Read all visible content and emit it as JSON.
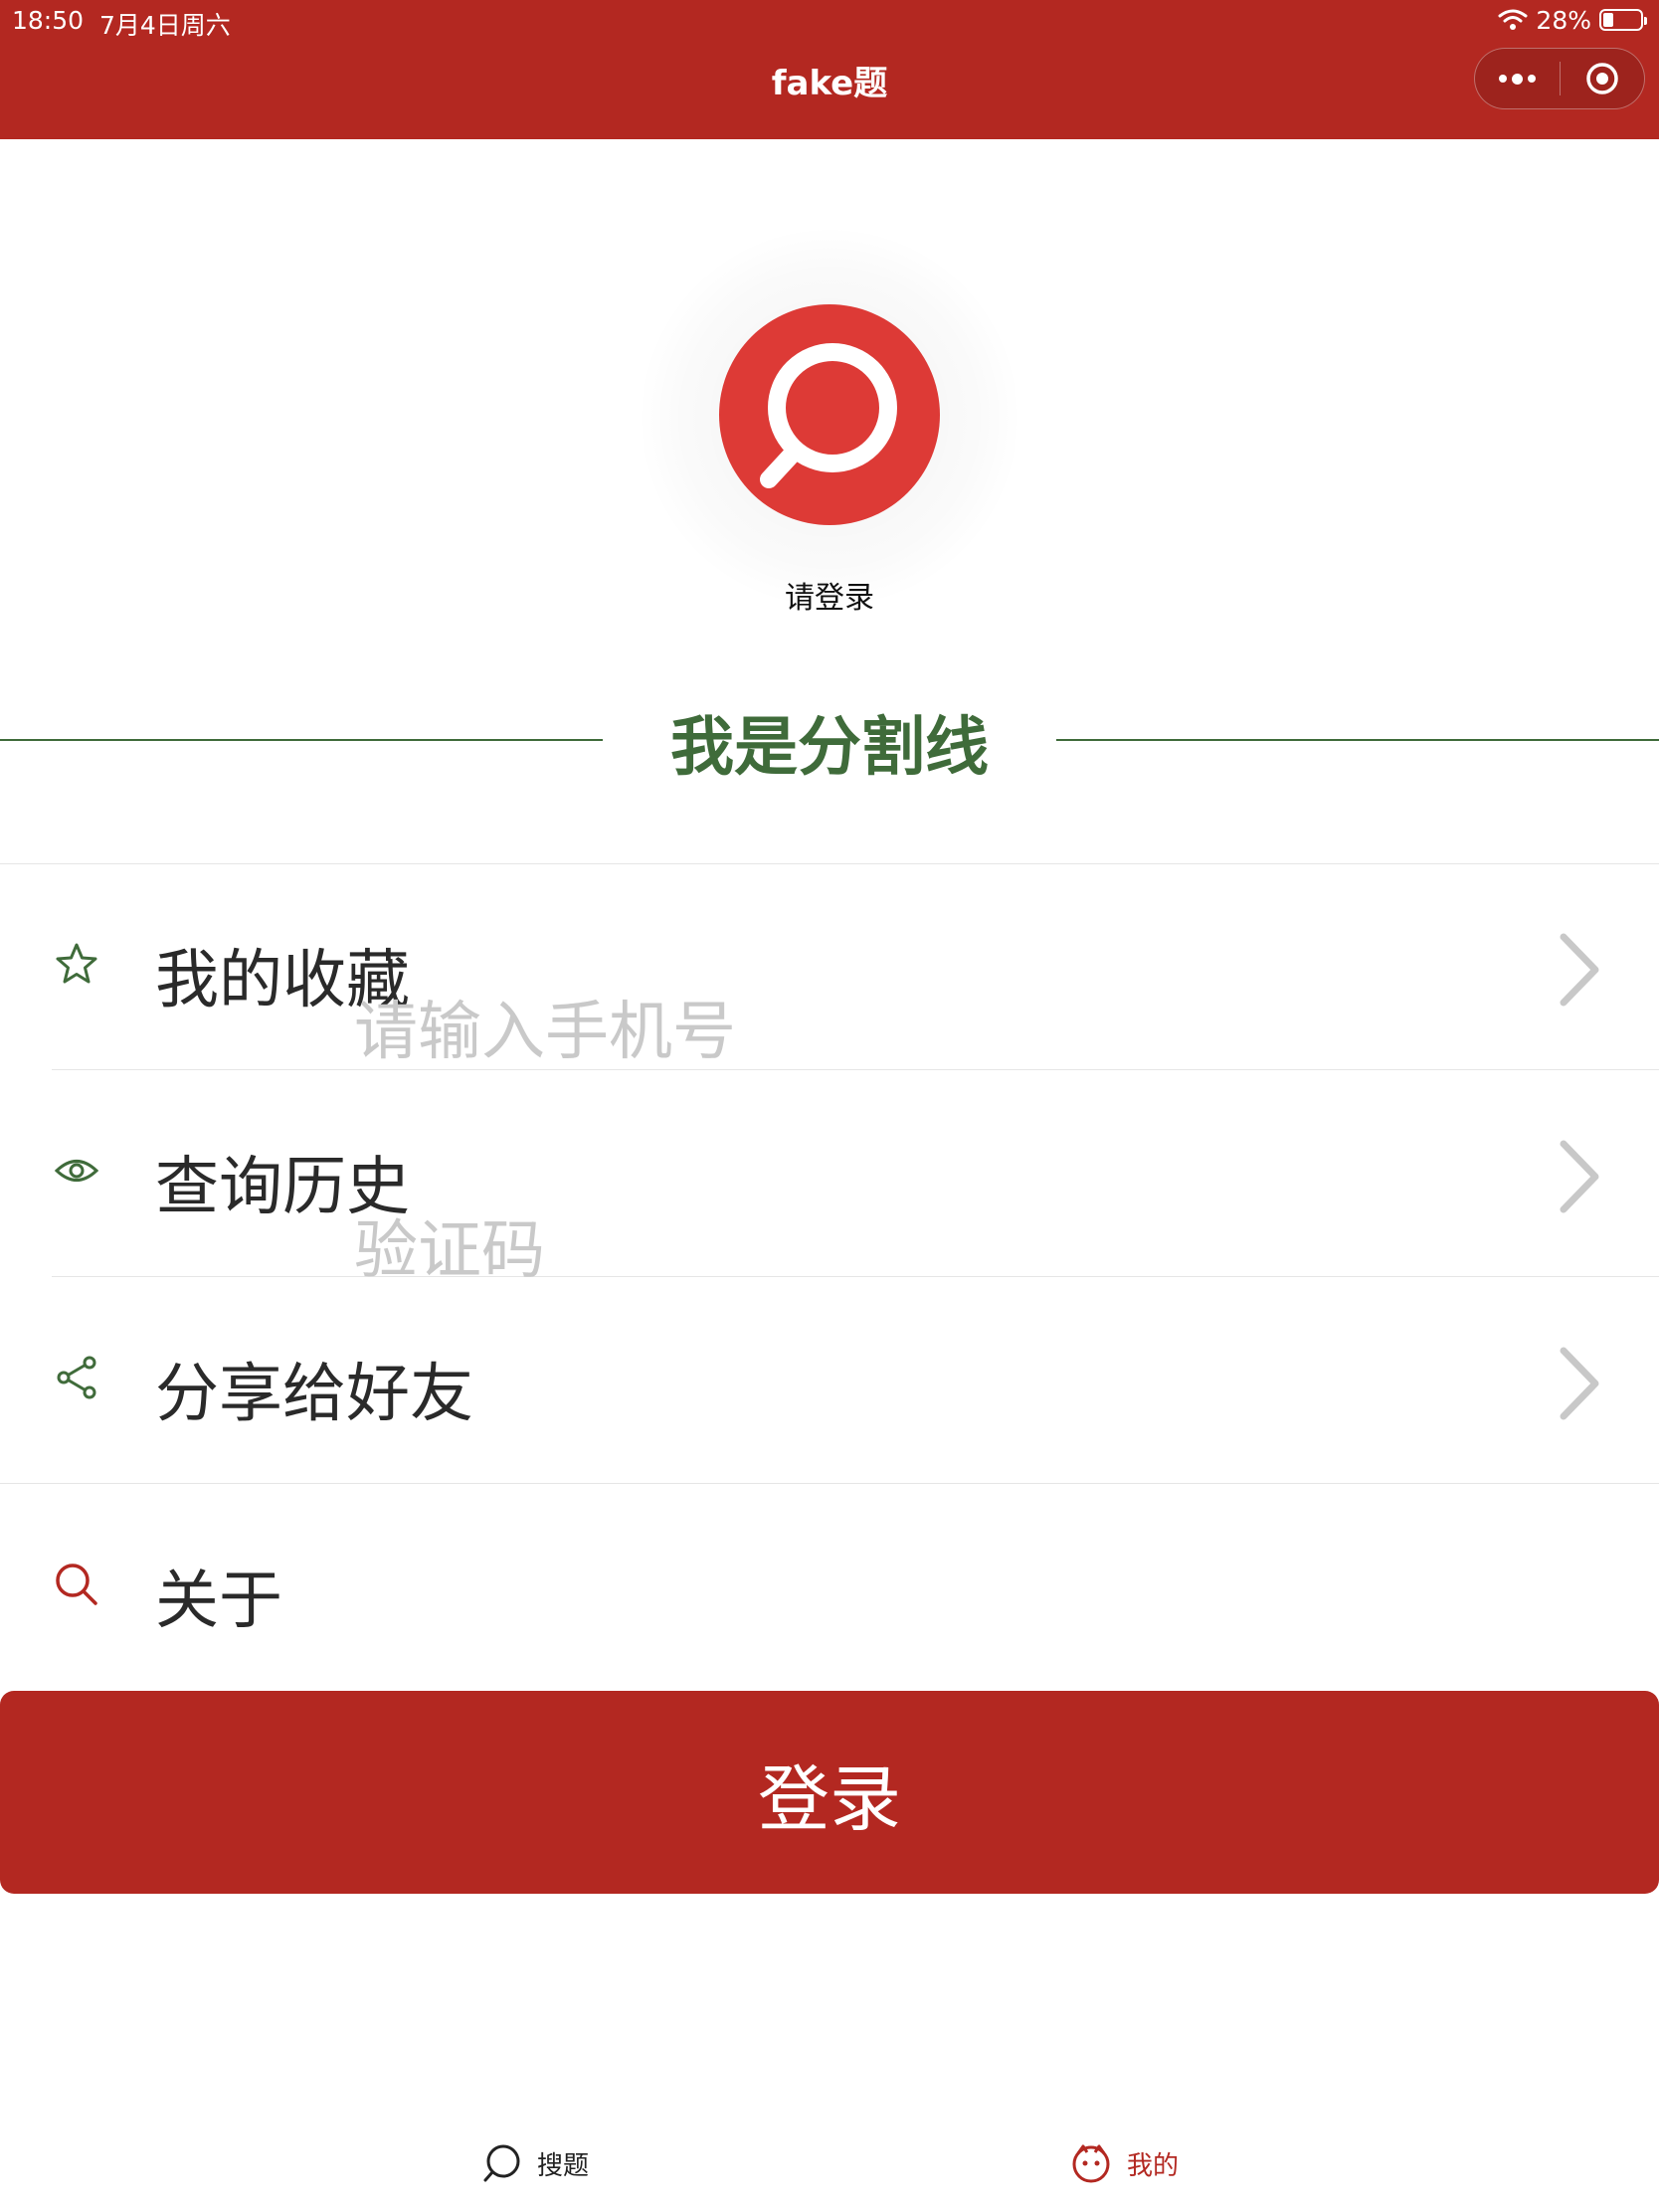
{
  "status_bar": {
    "time": "18:50",
    "date": "7月4日周六",
    "battery_percent": "28%",
    "battery_level": 0.28
  },
  "nav": {
    "title": "fake题"
  },
  "profile": {
    "login_prompt": "请登录"
  },
  "divider": {
    "text": "我是分割线"
  },
  "menu": {
    "items": [
      {
        "label": "我的收藏",
        "icon": "star-icon"
      },
      {
        "label": "查询历史",
        "icon": "eye-icon"
      },
      {
        "label": "分享给好友",
        "icon": "share-icon"
      },
      {
        "label": "关于",
        "icon": "search-icon"
      }
    ]
  },
  "form": {
    "phone_placeholder": "请输入手机号",
    "code_placeholder": "验证码"
  },
  "login_button": {
    "label": "登录"
  },
  "tabbar": {
    "tabs": [
      {
        "label": "搜题",
        "icon": "chat-bubble-icon"
      },
      {
        "label": "我的",
        "icon": "face-icon"
      }
    ]
  },
  "colors": {
    "brand_red": "#b32821",
    "avatar_red": "#dd3a36",
    "accent_green": "#3f6b3a"
  }
}
